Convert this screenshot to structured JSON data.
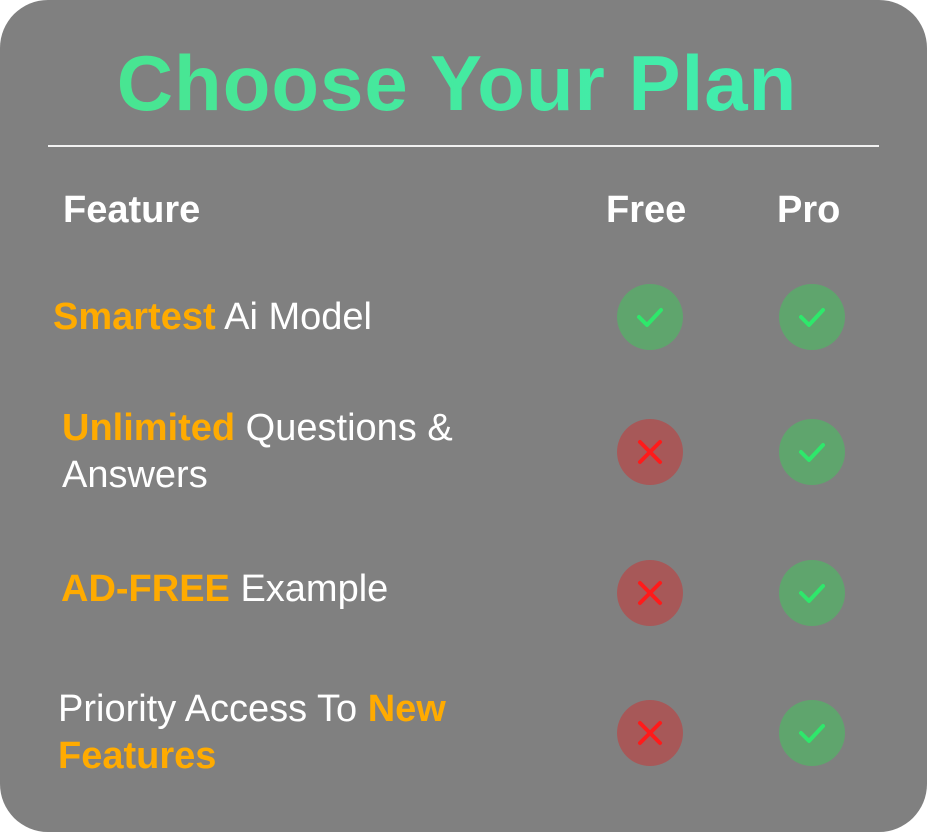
{
  "title": "Choose Your Plan",
  "columns": {
    "feature": "Feature",
    "free": "Free",
    "pro": "Pro"
  },
  "rows": [
    {
      "parts": [
        {
          "text": "Smartest",
          "highlight": true
        },
        {
          "text": " Ai Model",
          "highlight": false
        }
      ],
      "free": "check-icon",
      "pro": "check-icon"
    },
    {
      "parts": [
        {
          "text": "Unlimited",
          "highlight": true
        },
        {
          "text": " Questions & Answers",
          "highlight": false
        }
      ],
      "free": "cross-icon",
      "pro": "check-icon"
    },
    {
      "parts": [
        {
          "text": "AD-FREE",
          "highlight": true
        },
        {
          "text": " Example",
          "highlight": false
        }
      ],
      "free": "cross-icon",
      "pro": "check-icon"
    },
    {
      "parts": [
        {
          "text": "Priority Access To ",
          "highlight": false
        },
        {
          "text": "New Features",
          "highlight": true
        }
      ],
      "free": "cross-icon",
      "pro": "check-icon"
    }
  ],
  "colors": {
    "background": "#808080",
    "title_gradient_start": "#4ae38c",
    "title_gradient_end": "#3ff0b5",
    "highlight": "#ffab00",
    "check_bg": "#5fa56d",
    "check_mark": "#2ee86b",
    "cross_bg": "#a75858",
    "cross_mark": "#ff1a1a"
  }
}
